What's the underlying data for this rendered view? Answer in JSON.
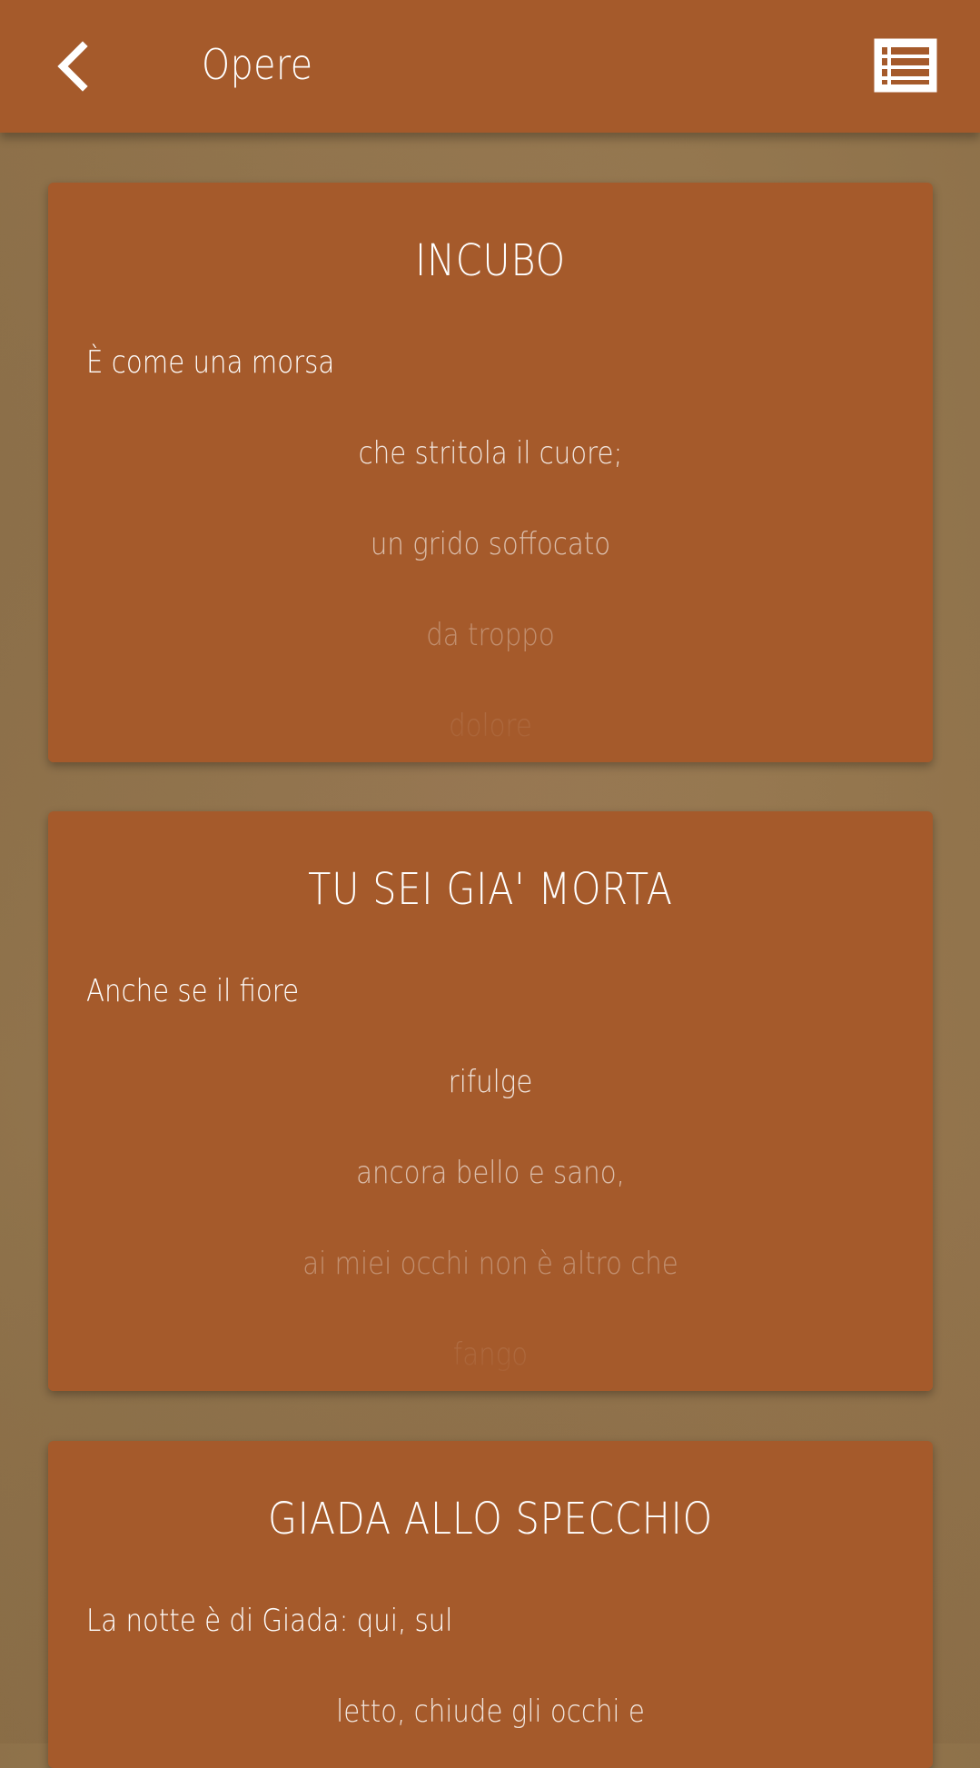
{
  "app_bar": {
    "title": "Opere",
    "back_icon": "chevron-left-icon",
    "menu_icon": "list-view-icon"
  },
  "colors": {
    "primary": "#a55a2b",
    "background": "#94774f",
    "text": "#ffffff"
  },
  "poems": [
    {
      "title": "INCUBO",
      "lines": [
        "È come una morsa",
        "che stritola il cuore;",
        "un grido soffocato",
        "da troppo",
        "dolore"
      ]
    },
    {
      "title": "TU SEI GIA' MORTA",
      "lines": [
        "Anche se il fiore",
        "rifulge",
        "ancora bello e sano,",
        "ai miei occhi non è altro che",
        "fango"
      ]
    },
    {
      "title": "GIADA ALLO SPECCHIO",
      "lines": [
        "La notte è di Giada: qui, sul",
        "letto, chiude gli occhi e"
      ]
    }
  ]
}
